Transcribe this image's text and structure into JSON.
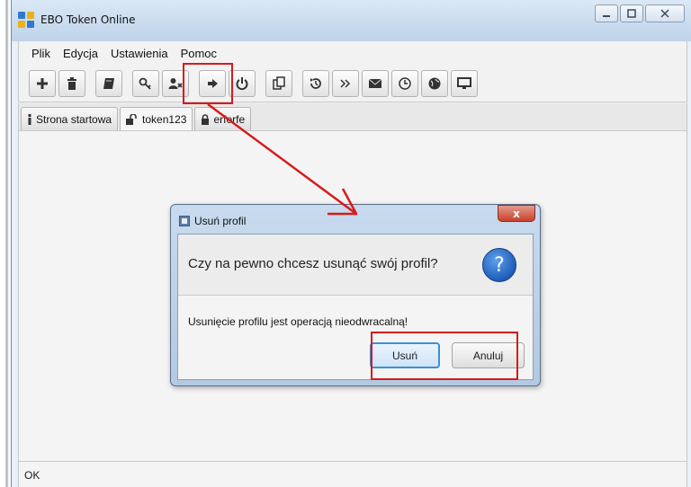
{
  "window": {
    "title": "EBO Token Online",
    "controls": [
      "minimize",
      "maximize",
      "close"
    ]
  },
  "menu": {
    "items": [
      "Plik",
      "Edycja",
      "Ustawienia",
      "Pomoc"
    ]
  },
  "toolbar": {
    "buttons": [
      {
        "icon": "plus-icon"
      },
      {
        "icon": "trash-icon"
      },
      {
        "icon": "book-icon"
      },
      {
        "icon": "key-icon"
      },
      {
        "icon": "user-remove-icon"
      },
      {
        "icon": "logout-icon"
      },
      {
        "icon": "power-icon"
      },
      {
        "icon": "copy-icon"
      },
      {
        "icon": "history-icon"
      },
      {
        "icon": "double-chevron-icon"
      },
      {
        "icon": "mail-icon"
      },
      {
        "icon": "clock-icon"
      },
      {
        "icon": "globe-icon"
      },
      {
        "icon": "monitor-icon"
      }
    ]
  },
  "tabs": [
    {
      "label": "Strona startowa",
      "icon": "info-icon"
    },
    {
      "label": "token123",
      "icon": "unlock-icon",
      "active": true
    },
    {
      "label": "erferfe",
      "icon": "lock-icon"
    }
  ],
  "status": {
    "text": "OK"
  },
  "dialog": {
    "title": "Usuń profil",
    "close_label": "x",
    "question": "Czy na pewno chcesz usunąć swój profil?",
    "message": "Usunięcie profilu jest operacją nieodwracalną!",
    "ok_label": "Usuń",
    "cancel_label": "Anuluj",
    "question_glyph": "?"
  },
  "colors": {
    "highlight": "#d81a1a",
    "titlebar": "#c9dbee",
    "accent_button": "#3c8fd6"
  }
}
